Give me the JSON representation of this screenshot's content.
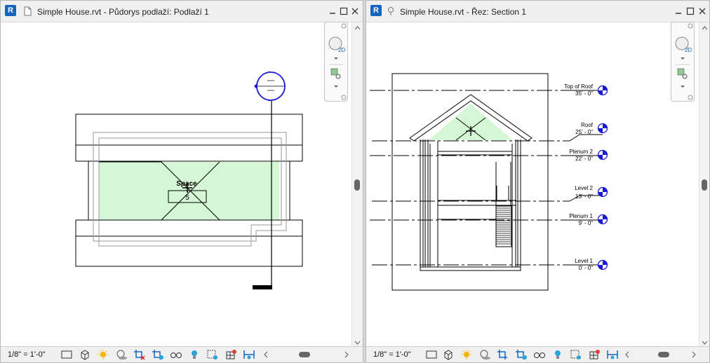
{
  "left_view": {
    "title": "Simple House.rvt - Půdorys podlaží: Podlaží 1",
    "space_label": "Space",
    "space_number": "5",
    "scale": "1/8\" = 1'-0\""
  },
  "right_view": {
    "title": "Simple House.rvt - Řez: Section 1",
    "scale": "1/8\" = 1'-0\"",
    "levels": [
      {
        "name": "Top of Roof",
        "elevation": "35' - 0\""
      },
      {
        "name": "Roof",
        "elevation": "25' - 0\""
      },
      {
        "name": "Plenum 2",
        "elevation": "22' - 0\""
      },
      {
        "name": "Level 2",
        "elevation": "13' - 0\""
      },
      {
        "name": "Plenum 1",
        "elevation": "9' - 0\""
      },
      {
        "name": "Level 1",
        "elevation": "0' - 0\""
      }
    ]
  },
  "navbar": {
    "wheel_label": "2D"
  },
  "colors": {
    "space_fill": "#d6f7d6",
    "revit_blue": "#1565c0",
    "section_marker": "#1a1ad6"
  }
}
